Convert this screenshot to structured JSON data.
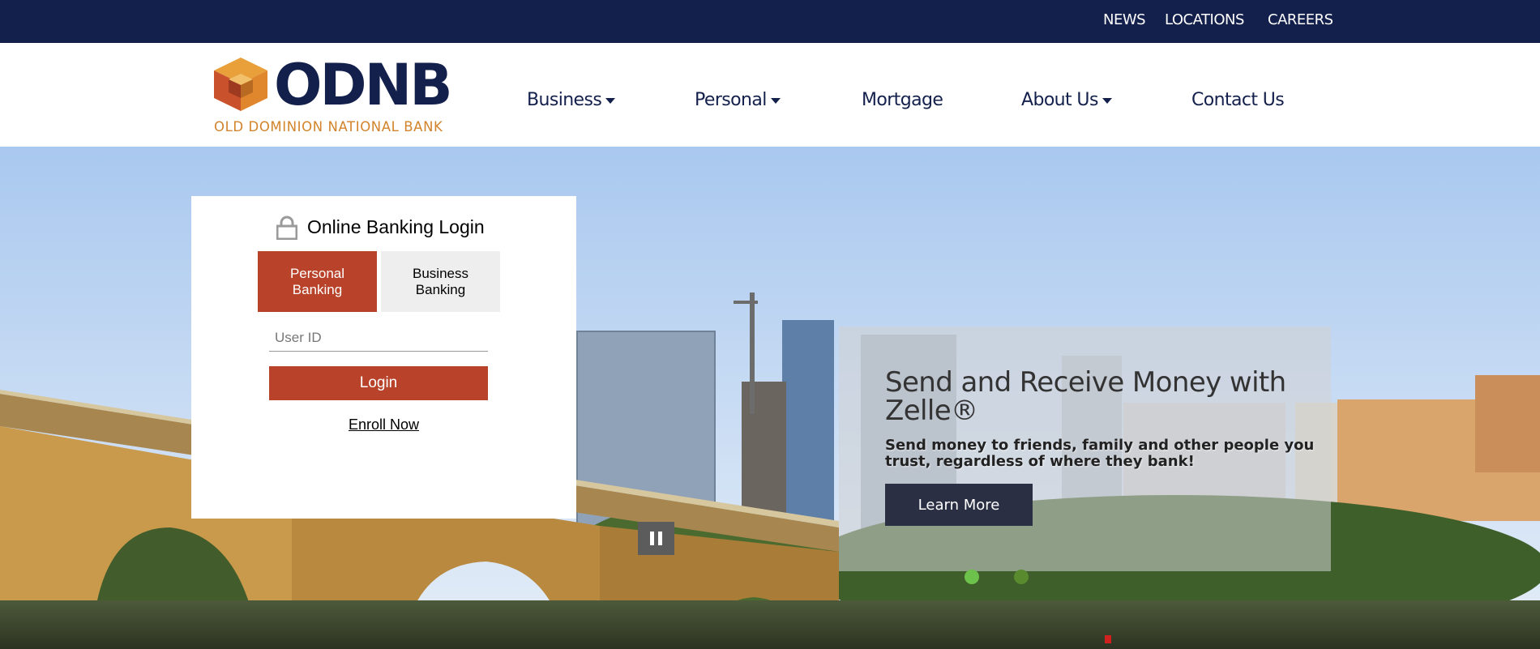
{
  "topbar": {
    "links": [
      "NEWS",
      "LOCATIONS",
      "CAREERS"
    ]
  },
  "logo": {
    "wordmark": "ODNB",
    "tagline": "OLD DOMINION NATIONAL BANK"
  },
  "nav": {
    "items": [
      {
        "label": "Business",
        "dropdown": true
      },
      {
        "label": "Personal",
        "dropdown": true
      },
      {
        "label": "Mortgage",
        "dropdown": false
      },
      {
        "label": "About Us",
        "dropdown": true
      },
      {
        "label": "Contact Us",
        "dropdown": false
      }
    ]
  },
  "login": {
    "title": "Online Banking Login",
    "tabs": [
      {
        "label": "Personal Banking",
        "active": true
      },
      {
        "label": "Business Banking",
        "active": false
      }
    ],
    "user_id_placeholder": "User ID",
    "user_id_value": "",
    "login_label": "Login",
    "enroll_label": "Enroll Now"
  },
  "slide": {
    "title": "Send and Receive Money with Zelle®",
    "text": "Send money to friends, family and other people you trust, regardless of where they bank!",
    "button_label": "Learn More"
  },
  "carousel": {
    "pause_icon": "pause-icon",
    "slide_count": 2,
    "active_index": 0
  },
  "colors": {
    "navy": "#13204c",
    "brand_red": "#b8432a",
    "logo_orange": "#d2832b",
    "dot_active": "#6cc24a",
    "dot_inactive": "#5a8a2e"
  }
}
